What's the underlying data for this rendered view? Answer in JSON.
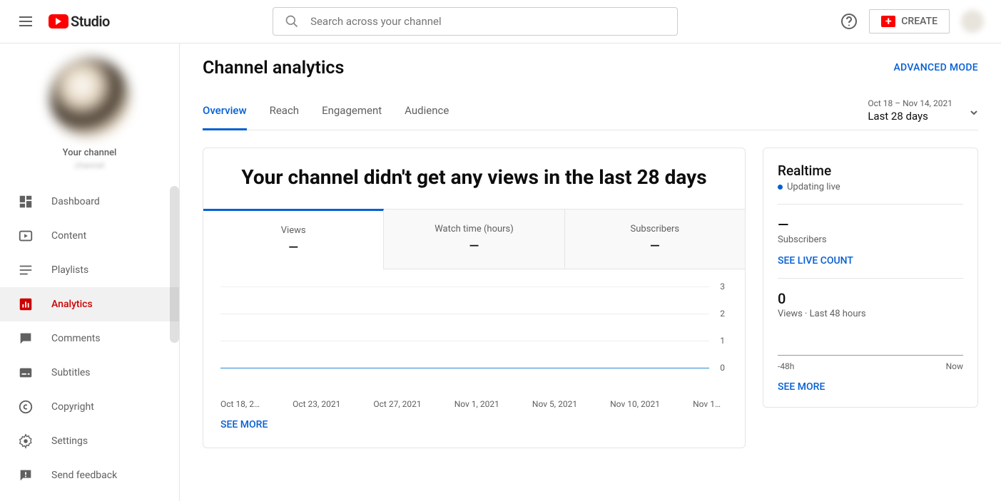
{
  "header": {
    "logo_text": "Studio",
    "search_placeholder": "Search across your channel",
    "create_label": "CREATE"
  },
  "sidebar": {
    "channel_label": "Your channel",
    "channel_name": "channel",
    "nav": [
      {
        "label": "Dashboard",
        "icon": "dashboard"
      },
      {
        "label": "Content",
        "icon": "content"
      },
      {
        "label": "Playlists",
        "icon": "playlists"
      },
      {
        "label": "Analytics",
        "icon": "analytics"
      },
      {
        "label": "Comments",
        "icon": "comments"
      },
      {
        "label": "Subtitles",
        "icon": "subtitles"
      },
      {
        "label": "Copyright",
        "icon": "copyright"
      },
      {
        "label": "Settings",
        "icon": "settings"
      },
      {
        "label": "Send feedback",
        "icon": "feedback"
      }
    ]
  },
  "page": {
    "title": "Channel analytics",
    "advanced_mode": "ADVANCED MODE",
    "tabs": [
      "Overview",
      "Reach",
      "Engagement",
      "Audience"
    ],
    "range_small": "Oct 18 – Nov 14, 2021",
    "range_main": "Last 28 days",
    "headline": "Your channel didn't get any views in the last 28 days",
    "metrics": [
      {
        "label": "Views",
        "value": "—"
      },
      {
        "label": "Watch time (hours)",
        "value": "—"
      },
      {
        "label": "Subscribers",
        "value": "—"
      }
    ],
    "chart_y": [
      "3",
      "2",
      "1",
      "0"
    ],
    "chart_x": [
      "Oct 18, 2…",
      "Oct 23, 2021",
      "Oct 27, 2021",
      "Nov 1, 2021",
      "Nov 5, 2021",
      "Nov 10, 2021",
      "Nov 1…"
    ],
    "see_more": "SEE MORE"
  },
  "realtime": {
    "title": "Realtime",
    "updating": "Updating live",
    "subscribers_value": "—",
    "subscribers_label": "Subscribers",
    "live_count": "SEE LIVE COUNT",
    "views_value": "0",
    "views_label": "Views · Last 48 hours",
    "axis_left": "-48h",
    "axis_right": "Now",
    "see_more": "SEE MORE"
  },
  "chart_data": {
    "type": "line",
    "title": "Views",
    "xlabel": "",
    "ylabel": "",
    "ylim": [
      0,
      3
    ],
    "categories": [
      "Oct 18, 2021",
      "Oct 23, 2021",
      "Oct 27, 2021",
      "Nov 1, 2021",
      "Nov 5, 2021",
      "Nov 10, 2021",
      "Nov 14, 2021"
    ],
    "series": [
      {
        "name": "Views",
        "values": [
          0,
          0,
          0,
          0,
          0,
          0,
          0
        ]
      }
    ]
  }
}
